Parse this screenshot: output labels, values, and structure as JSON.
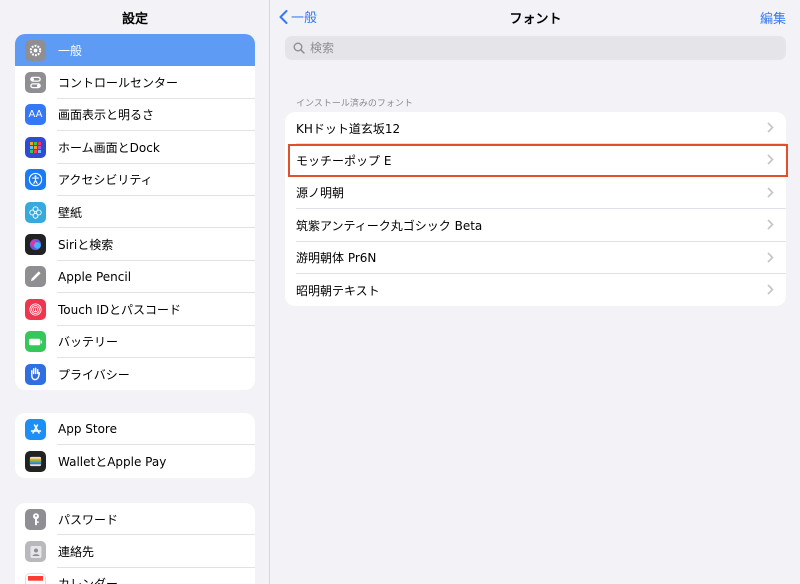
{
  "sidebar": {
    "title": "設定",
    "group1": [
      {
        "label": "一般",
        "icon": "gear-icon",
        "color": "#8e8e93",
        "selected": true
      },
      {
        "label": "コントロールセンター",
        "icon": "toggles-icon",
        "color": "#8e8e93"
      },
      {
        "label": "画面表示と明るさ",
        "icon": "text-size-icon",
        "color": "#3478f6"
      },
      {
        "label": "ホーム画面とDock",
        "icon": "app-grid-icon",
        "color": "#2f4bd6"
      },
      {
        "label": "アクセシビリティ",
        "icon": "accessibility-icon",
        "color": "#1a7cf5"
      },
      {
        "label": "壁紙",
        "icon": "wallpaper-flower-icon",
        "color": "#35aadc"
      },
      {
        "label": "Siriと検索",
        "icon": "siri-icon",
        "color": "#222"
      },
      {
        "label": "Apple Pencil",
        "icon": "pencil-icon",
        "color": "#8e8e93"
      },
      {
        "label": "Touch IDとパスコード",
        "icon": "fingerprint-icon",
        "color": "#f0364f"
      },
      {
        "label": "バッテリー",
        "icon": "battery-icon",
        "color": "#34c759"
      },
      {
        "label": "プライバシー",
        "icon": "hand-icon",
        "color": "#2f6fe0"
      }
    ],
    "group2": [
      {
        "label": "App Store",
        "icon": "app-store-icon",
        "color": "#1c8ef5"
      },
      {
        "label": "WalletとApple Pay",
        "icon": "wallet-icon",
        "color": "#222"
      }
    ],
    "group3": [
      {
        "label": "パスワード",
        "icon": "key-icon",
        "color": "#8e8e93"
      },
      {
        "label": "連絡先",
        "icon": "contacts-icon",
        "color": "#b8b8bd"
      },
      {
        "label": "カレンダー",
        "icon": "calendar-icon",
        "color": "#ff3b30"
      }
    ]
  },
  "nav": {
    "back_label": "一般",
    "title": "フォント",
    "edit_label": "編集"
  },
  "search": {
    "placeholder": "検索",
    "value": ""
  },
  "fonts": {
    "section_header": "インストール済みのフォント",
    "items": [
      {
        "label": "KHドット道玄坂12"
      },
      {
        "label": "モッチーポップ E",
        "highlighted": true
      },
      {
        "label": "源ノ明朝"
      },
      {
        "label": "筑紫アンティーク丸ゴシック Beta"
      },
      {
        "label": "游明朝体 Pr6N"
      },
      {
        "label": "昭明朝テキスト"
      }
    ]
  },
  "colors": {
    "accent": "#3478f6",
    "selection": "#5e9bf5",
    "highlight_box": "#e0502b"
  }
}
